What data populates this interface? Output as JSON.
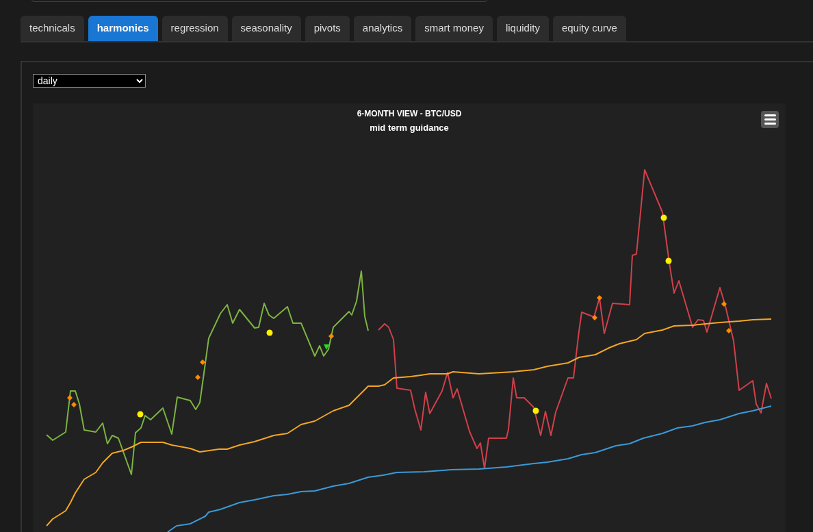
{
  "tabs": [
    {
      "label": "technicals",
      "selected": false
    },
    {
      "label": "harmonics",
      "selected": true
    },
    {
      "label": "regression",
      "selected": false
    },
    {
      "label": "seasonality",
      "selected": false
    },
    {
      "label": "pivots",
      "selected": false
    },
    {
      "label": "analytics",
      "selected": false
    },
    {
      "label": "smart money",
      "selected": false
    },
    {
      "label": "liquidity",
      "selected": false
    },
    {
      "label": "equity curve",
      "selected": false
    }
  ],
  "timeframe_select": {
    "value": "daily"
  },
  "chart": {
    "title": "6-MONTH VIEW - BTC/USD",
    "subtitle": "mid term guidance"
  }
}
